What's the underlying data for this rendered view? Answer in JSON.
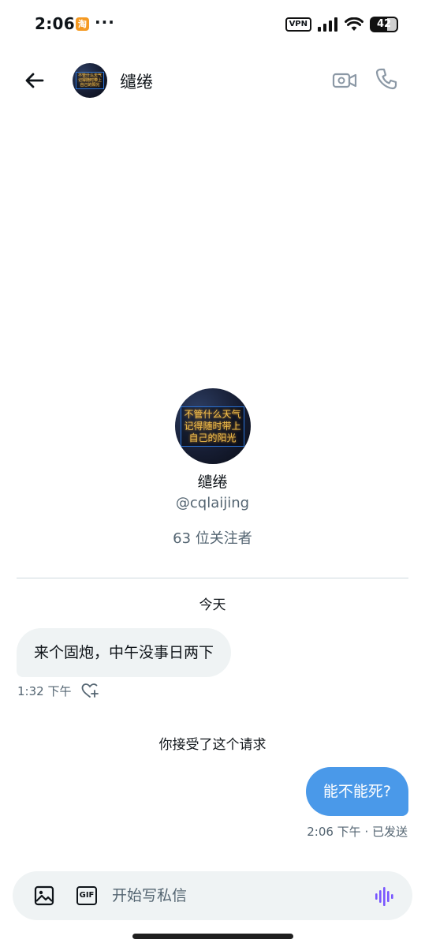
{
  "status_bar": {
    "time": "2:06",
    "app_badge": "淘",
    "dots": "···",
    "vpn": "VPN",
    "battery": "42"
  },
  "header": {
    "name": "缱绻",
    "avatar_lines": [
      "不管什么天气",
      "记得随时带上",
      "自己的阳光"
    ]
  },
  "profile": {
    "name": "缱绻",
    "handle": "@cqlaijing",
    "followers": "63 位关注者"
  },
  "conversation": {
    "date_separator": "今天",
    "incoming": {
      "text": "来个固炮，中午没事日两下",
      "time": "1:32 下午"
    },
    "system_note": "你接受了这个请求",
    "outgoing": {
      "text": "能不能死?",
      "meta": "2:06 下午 · 已发送"
    }
  },
  "composer": {
    "gif_label": "GIF",
    "placeholder": "开始写私信"
  },
  "colors": {
    "accent": "#4a99e9",
    "bubble_in": "#eff3f4",
    "secondary_text": "#536471",
    "voice_icon": "#7856ff"
  }
}
